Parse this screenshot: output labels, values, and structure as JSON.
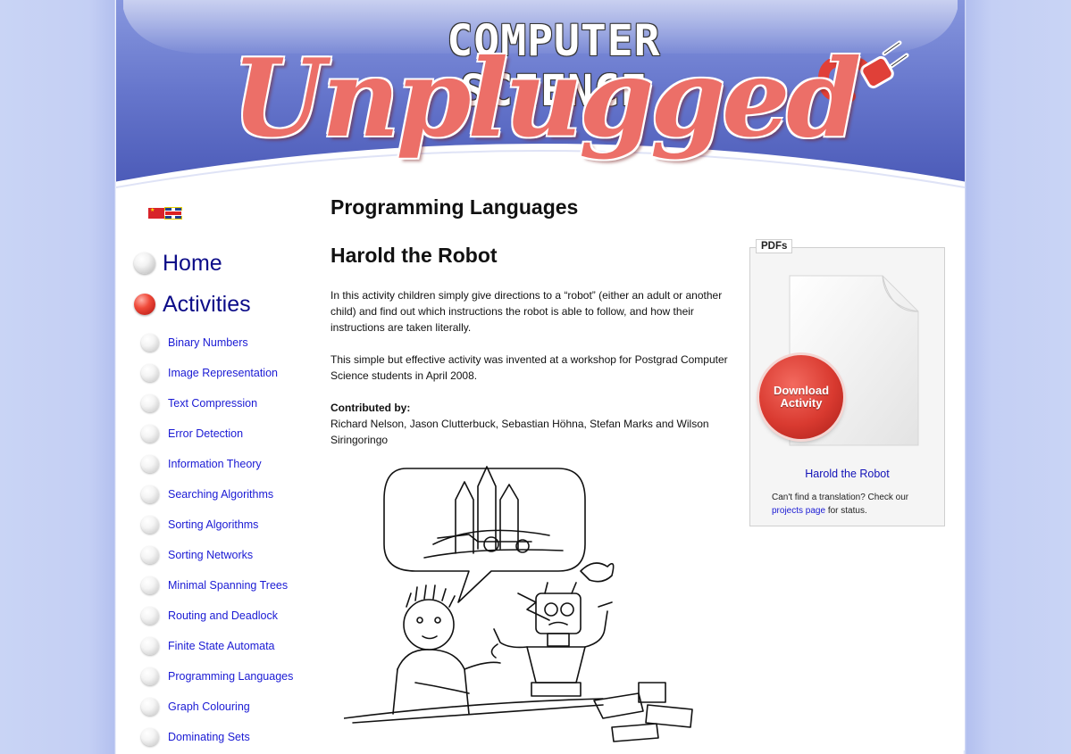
{
  "header": {
    "logo_top": "COMPUTER SCIENCE",
    "logo_script": "Unplugged"
  },
  "languages": [
    "chinese-flag-icon",
    "uk-flag-icon"
  ],
  "nav": {
    "home": "Home",
    "activities": "Activities",
    "items": [
      "Binary Numbers",
      "Image Representation",
      "Text Compression",
      "Error Detection",
      "Information Theory",
      "Searching Algorithms",
      "Sorting Algorithms",
      "Sorting Networks",
      "Minimal Spanning Trees",
      "Routing and Deadlock",
      "Finite State Automata",
      "Programming Languages",
      "Graph Colouring",
      "Dominating Sets"
    ]
  },
  "main": {
    "section_title": "Programming Languages",
    "page_title": "Harold the Robot",
    "para1": "In this activity children simply give directions to a “robot” (either an adult or another child) and find out which instructions the robot is able to follow, and how their instructions are taken literally.",
    "para2": "This simple but effective activity was invented at a workshop for Postgrad Computer Science students in April 2008.",
    "contributed_heading": "Contributed by:",
    "contributors": "Richard Nelson, Jason Clutterbuck, Sebastian Höhna, Stefan Marks and Wilson Siringoringo"
  },
  "pdfs": {
    "legend": "PDFs",
    "badge_line1": "Download",
    "badge_line2": "Activity",
    "link": "Harold the Robot",
    "note_before": "Can't find a translation? Check our",
    "note_link": "projects page",
    "note_after": "for status."
  },
  "colors": {
    "header_blue": "#5a6cc6",
    "nav_link": "#1a1ad4",
    "nav_main": "#0c0c88",
    "badge_red": "#d93a30"
  }
}
